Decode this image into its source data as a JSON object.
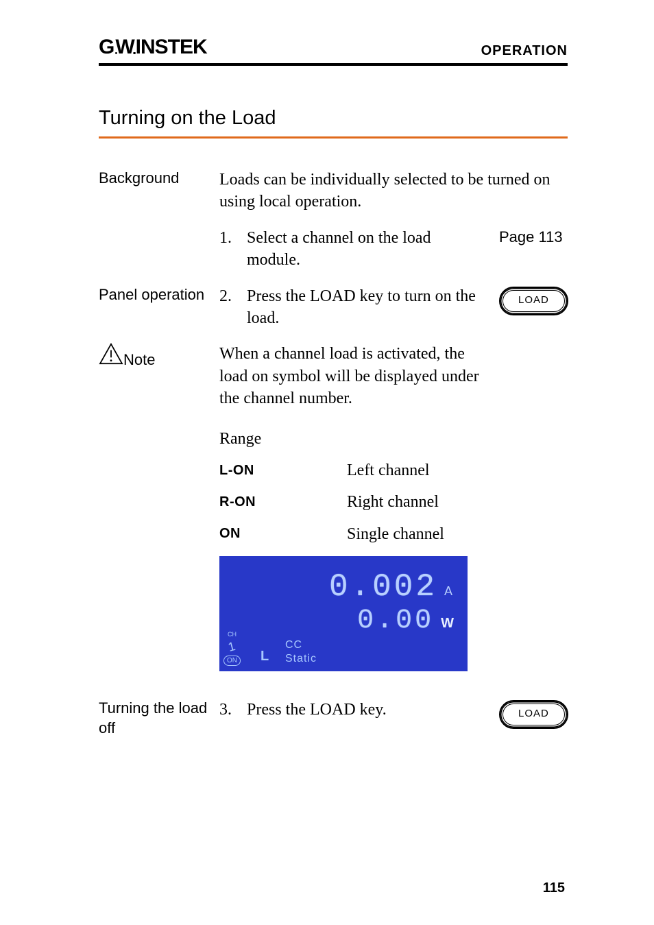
{
  "header": {
    "brand": "GWINSTEK",
    "section": "OPERATION"
  },
  "title": "Turning on the Load",
  "rows": {
    "background": {
      "label": "Background",
      "text": "Loads can be individually selected to be turned on using local operation."
    },
    "step1": {
      "num": "1.",
      "text": "Select a channel on the load module.",
      "ref": "Page 113"
    },
    "panel": {
      "label": "Panel operation",
      "num": "2.",
      "text": "Press the LOAD key to turn on the load.",
      "button": "LOAD"
    },
    "note": {
      "label": "Note",
      "text": "When a channel load is activated, the load on symbol will be displayed under the channel number."
    },
    "range": {
      "title": "Range",
      "items": [
        {
          "sym": "L-ON",
          "desc": "Left channel"
        },
        {
          "sym": "R-ON",
          "desc": "Right channel"
        },
        {
          "sym": "ON",
          "desc": "Single channel"
        }
      ]
    },
    "lcd": {
      "reading_a": "0.002",
      "unit_a": "A",
      "reading_w": "0.00",
      "unit_w": "W",
      "ch": "CH",
      "ch_num": "1",
      "on": "ON",
      "l": "L",
      "mode1": "CC",
      "mode2": "Static"
    },
    "off": {
      "label": "Turning the load off",
      "num": "3.",
      "text": "Press the LOAD key.",
      "button": "LOAD"
    }
  },
  "page_number": "115"
}
